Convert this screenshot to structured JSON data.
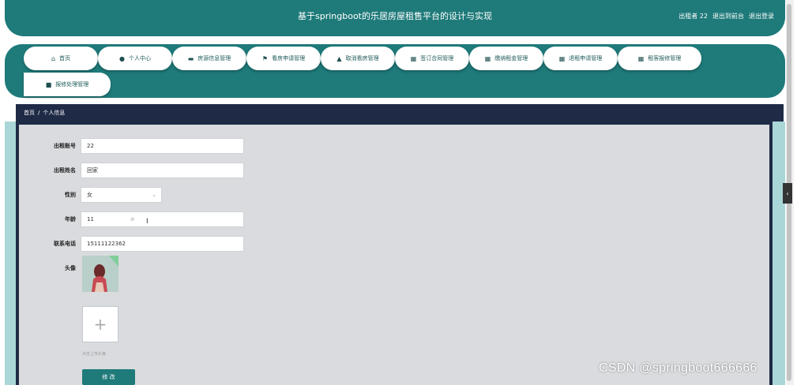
{
  "header": {
    "title": "基于springboot的乐居房屋租售平台的设计与实现",
    "user": "出租者 22",
    "backend": "退出到前台",
    "logout": "退出登录"
  },
  "nav": {
    "items": [
      {
        "label": "首页",
        "icon": "home-icon"
      },
      {
        "label": "个人中心",
        "icon": "user-icon"
      },
      {
        "label": "房源信息管理",
        "icon": "comment-icon"
      },
      {
        "label": "看房申请管理",
        "icon": "flag-icon"
      },
      {
        "label": "取消看房管理",
        "icon": "thumb-icon"
      },
      {
        "label": "签订合同管理",
        "icon": "grid-icon"
      },
      {
        "label": "缴纳租金管理",
        "icon": "grid-icon"
      },
      {
        "label": "退租申请管理",
        "icon": "grid-icon"
      },
      {
        "label": "租客报修管理",
        "icon": "grid-icon"
      },
      {
        "label": "报修处理管理",
        "icon": "briefcase-icon"
      }
    ]
  },
  "breadcrumb": {
    "home": "首页",
    "separator": "/",
    "current": "个人信息"
  },
  "form": {
    "account_label": "出租账号",
    "account_value": "22",
    "name_label": "出租姓名",
    "name_value": "回家",
    "gender_label": "性别",
    "gender_value": "女",
    "age_label": "年龄",
    "age_value": "11",
    "phone_label": "联系电话",
    "phone_value": "15111122362",
    "avatar_label": "头像",
    "upload_hint": "点击上传头像",
    "upload_glyph": "+",
    "submit_label": "修 改"
  },
  "side_tab": "‹",
  "watermark": "CSDN @springboot666666",
  "colors": {
    "primary": "#1f7a7a",
    "dark": "#1e2a46",
    "light": "#a9d6d7"
  }
}
